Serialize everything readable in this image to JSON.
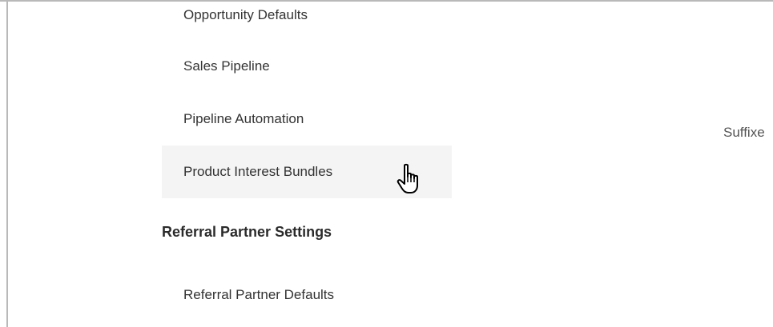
{
  "settings_nav": {
    "clipped_item": "Opportunity Defaults",
    "items": [
      {
        "label": "Sales Pipeline"
      },
      {
        "label": "Pipeline Automation"
      },
      {
        "label": "Product Interest Bundles",
        "hovered": true
      }
    ],
    "section_heading": "Referral Partner Settings",
    "section_items": [
      {
        "label": "Referral Partner Defaults"
      }
    ]
  },
  "right_panel": {
    "partial_label": "Suffixe"
  },
  "cursor": {
    "icon": "hand-pointer-icon"
  }
}
